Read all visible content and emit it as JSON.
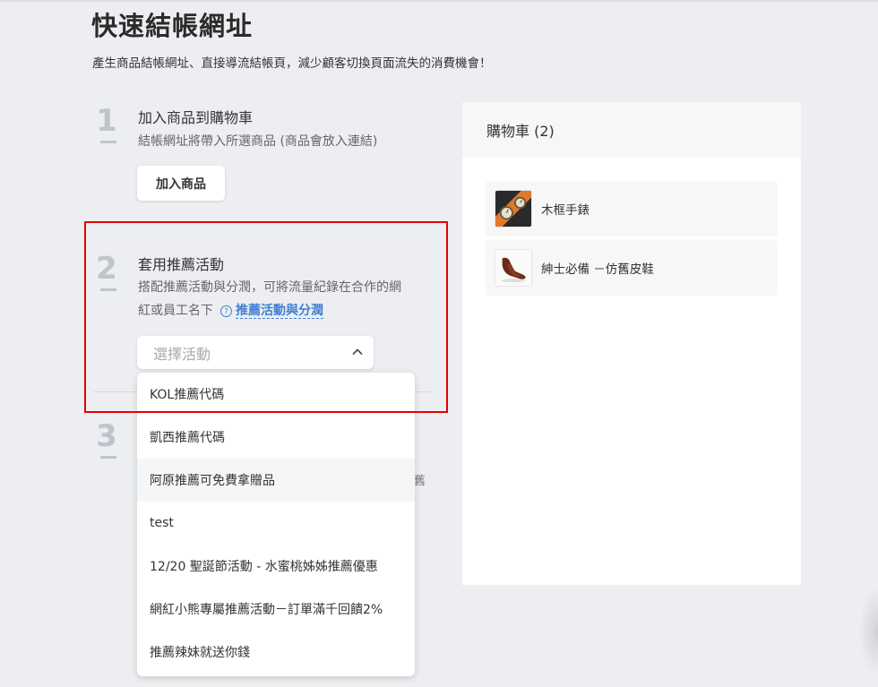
{
  "page": {
    "title": "快速結帳網址",
    "subtitle": "產生商品結帳網址、直接導流結帳頁，減少顧客切換頁面流失的消費機會！"
  },
  "step1": {
    "number": "1",
    "title": "加入商品到購物車",
    "desc": "結帳網址將帶入所選商品 (商品會放入連結)",
    "button_label": "加入商品"
  },
  "step2": {
    "number": "2",
    "title": "套用推薦活動",
    "desc_line1": "搭配推薦活動與分潤，可將流量紀錄在合作的網",
    "desc_line2": "紅或員工名下",
    "help_icon": "?",
    "help_link": "推薦活動與分潤",
    "select_placeholder": "選擇活動"
  },
  "step3": {
    "number": "3",
    "partial_text": "舊"
  },
  "dropdown": {
    "options": [
      "KOL推薦代碼",
      "凱西推薦代碼",
      "阿原推薦可免費拿贈品",
      "test",
      "12/20 聖誕節活動 - 水蜜桃姊姊推薦優惠",
      "網紅小熊專屬推薦活動－訂單滿千回饋2%",
      "推薦辣妹就送你錢"
    ],
    "hovered_index": 2
  },
  "cart": {
    "title": "購物車 (2)",
    "items": [
      {
        "name": "木框手錶",
        "icon": "watch-thumbnail"
      },
      {
        "name": "紳士必備 －仿舊皮鞋",
        "icon": "shoe-thumbnail"
      }
    ]
  },
  "colors": {
    "accent": "#3f7fd6",
    "highlight_border": "#e60000",
    "step_number": "#bfc4cc",
    "background": "#eceef1"
  }
}
